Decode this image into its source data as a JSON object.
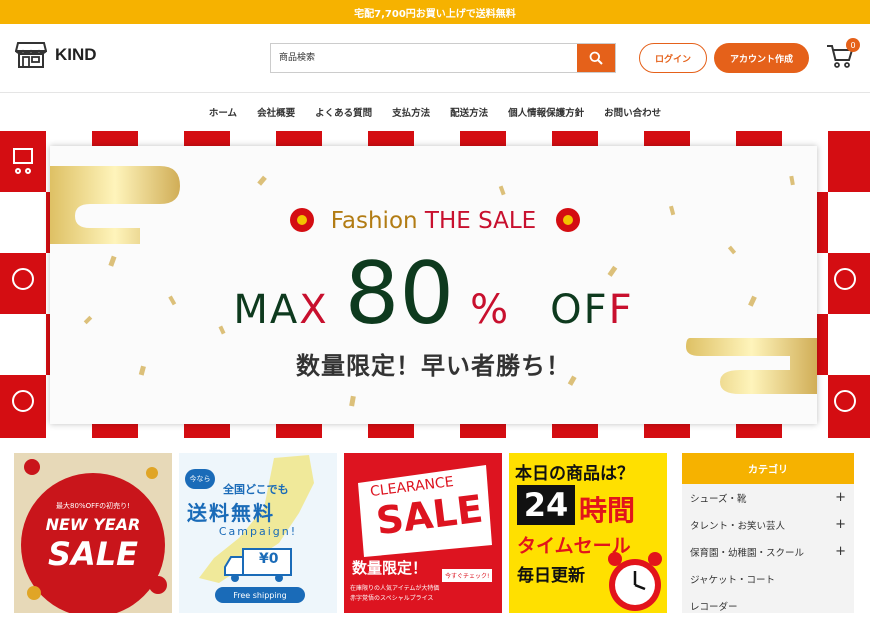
{
  "topbar": {
    "text": "宅配7,700円お買い上げで送料無料"
  },
  "header": {
    "logo_text": "KIND",
    "search_placeholder": "商品検索",
    "login_label": "ログイン",
    "signup_label": "アカウント作成",
    "cart_count": "0",
    "accent_color": "#e5611a"
  },
  "nav": {
    "items": [
      "ホーム",
      "会社概要",
      "よくある質問",
      "支払方法",
      "配送方法",
      "個人情報保護方針",
      "お問い合わせ"
    ]
  },
  "hero": {
    "title_part1": "Fashion ",
    "title_part2": "THE SALE",
    "max_a": "MA",
    "max_b": "X",
    "number": "80",
    "percent": "%",
    "off_a": "OF",
    "off_b": "F",
    "subtitle": "数量限定！早い者勝ち！"
  },
  "promos": {
    "newyear": {
      "small": "最大80%OFFの初売り!",
      "title1": "NEW YEAR",
      "title2": "SALE"
    },
    "shipping": {
      "bubble": "今なら",
      "line1": "全国どこでも",
      "line2": "送料無料",
      "line3": "Campaign!",
      "price": "¥0",
      "footer": "Free shipping"
    },
    "clearance": {
      "line1": "CLEARANCE",
      "line2": "SALE",
      "line3": "数量限定！",
      "small1": "在庫限りの人気アイテムが大特価",
      "small2": "赤字覚悟のスペシャルプライス",
      "tag": "今すぐチェック!"
    },
    "timesale": {
      "line1": "本日の商品は？",
      "digits": "24",
      "line2": "時間",
      "line3": "タイムセール",
      "line4": "毎日更新"
    }
  },
  "category": {
    "title": "カテゴリ",
    "items": [
      {
        "label": "シューズ・靴",
        "plus": "+"
      },
      {
        "label": "タレント・お笑い芸人",
        "plus": "+"
      },
      {
        "label": "保育園・幼稚園・スクール",
        "plus": "+"
      },
      {
        "label": "ジャケット・コート",
        "plus": ""
      },
      {
        "label": "レコーダー",
        "plus": ""
      }
    ]
  }
}
